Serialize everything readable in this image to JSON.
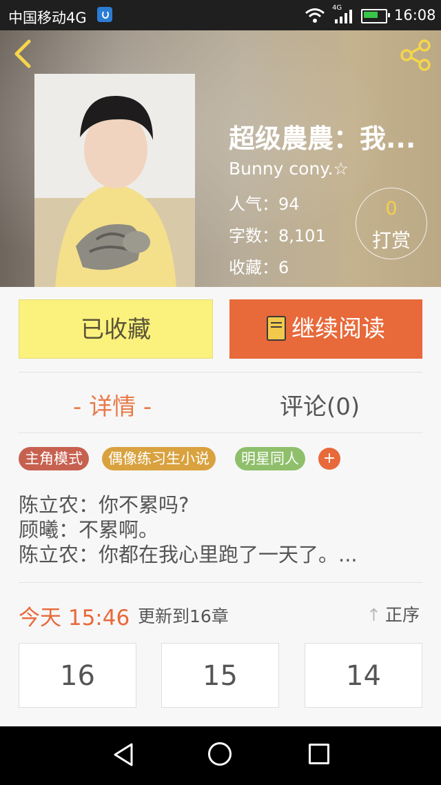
{
  "status_bar": {
    "carrier": "中国移动4G",
    "network_label": "4G",
    "time": "16:08",
    "icons": [
      "wifi-icon",
      "signal-icon",
      "battery-icon"
    ]
  },
  "header": {
    "back_icon": "chevron-left-icon",
    "share_icon": "share-icon"
  },
  "book": {
    "title": "超级農農：我...",
    "author": "Bunny cony.☆",
    "popularity_label": "人气：",
    "popularity": "94",
    "word_count_label": "字数：",
    "word_count": "8,101",
    "favorites_label": "收藏：",
    "favorites": "6",
    "reward_count": "0",
    "reward_label": "打赏"
  },
  "actions": {
    "collected_label": "已收藏",
    "continue_label": "继续阅读"
  },
  "tabs": [
    {
      "label": "- 详情 -",
      "active": true
    },
    {
      "label": "评论(0)",
      "active": false
    }
  ],
  "tags": [
    "主角模式",
    "偶像练习生小说",
    "明星同人"
  ],
  "tag_add": "+",
  "summary": [
    "陈立农：你不累吗?",
    "顾曦：不累啊。",
    "陈立农：你都在我心里跑了一天了。..."
  ],
  "update": {
    "time": "今天 15:46",
    "text": "更新到16章",
    "sort_label": "正序",
    "sort_icon": "arrow-up-icon"
  },
  "chapters": [
    "16",
    "15",
    "14"
  ],
  "nav_bar": {
    "icons": [
      "back-triangle-icon",
      "home-circle-icon",
      "recent-square-icon"
    ]
  },
  "colors": {
    "accent": "#e8693a",
    "collected_bg": "#fbf17d",
    "reward_gold": "#f6cf4a",
    "tag1": "#c7614f",
    "tag2": "#d9a23f",
    "tag3": "#8fbf6b"
  }
}
